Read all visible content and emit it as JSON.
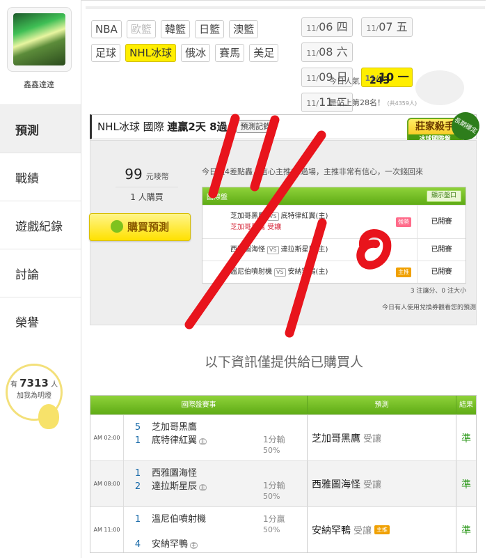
{
  "user": {
    "name": "鑫鑫達達"
  },
  "nav": [
    {
      "label": "預測",
      "active": true
    },
    {
      "label": "戰績"
    },
    {
      "label": "遊戲紀錄"
    },
    {
      "label": "討論"
    },
    {
      "label": "榮譽"
    }
  ],
  "fans": {
    "prefix": "有",
    "count": "7313",
    "suffix": "人",
    "subtitle": "加我為明燈"
  },
  "categories": [
    {
      "label": "NBA"
    },
    {
      "label": "歐籃",
      "disabled": true
    },
    {
      "label": "韓籃"
    },
    {
      "label": "日籃"
    },
    {
      "label": "澳籃"
    },
    {
      "label": "足球"
    },
    {
      "label": "NHL冰球",
      "active": true
    },
    {
      "label": "俄冰"
    },
    {
      "label": "賽馬"
    },
    {
      "label": "美足"
    }
  ],
  "dates": [
    {
      "md": "11/",
      "d": "06",
      "w": "四"
    },
    {
      "md": "11/",
      "d": "07",
      "w": "五"
    },
    {
      "md": "11/",
      "d": "08",
      "w": "六"
    },
    {
      "md": "11/",
      "d": "09",
      "w": "日"
    },
    {
      "md": "11/",
      "d": "10",
      "w": "一",
      "active": true
    },
    {
      "md": "11/",
      "d": "11",
      "w": "二"
    }
  ],
  "stats": {
    "popularity_label": "今日人氣",
    "popularity_value": "243",
    "rank_text": "是站上第28名！",
    "rank_note": "(共4359人)"
  },
  "prediction": {
    "league": "NHL冰球 國際",
    "streak": "連贏2天 8過",
    "record_button": "預測記錄",
    "badge_title": "莊家殺手",
    "badge_sub": "冰球國際盤",
    "badge_long": "長期穩定",
    "price": "99",
    "price_unit": "元嘜幣",
    "buyers": "1 人購買",
    "buy_button": "購買預測",
    "note": "今日過4差點轟，信心主推99過場，主推非常有信心，一次錢回來",
    "mini_header": "國際盤",
    "mini_show_button": "顯示盤口",
    "mini_rows": [
      {
        "away": "芝加哥黑鷹",
        "vs": "VS",
        "home": "底特律紅翼(主)",
        "pick": "芝加哥黑鷹 受讓",
        "tag": "強勢",
        "tag_style": "pink",
        "status": "已開賽"
      },
      {
        "away": "西雅圖海怪",
        "vs": "VS",
        "home": "達拉斯星辰(主)",
        "pick": "",
        "tag": "",
        "status": "已開賽"
      },
      {
        "away": "溫尼伯噴射機",
        "vs": "VS",
        "home": "安納罕鴨(主)",
        "pick": "",
        "tag": "主推",
        "tag_style": "orange",
        "status": "已開賽"
      }
    ],
    "mini_foot": "3 注讓分、0 注大小",
    "mini_foot2": "今日有人使用兌換券觀看您的預測"
  },
  "info_text": "以下資訊僅提供給已購買人",
  "results": {
    "headers": {
      "event": "國際盤賽事",
      "pred": "預測",
      "result": "結果"
    },
    "rows": [
      {
        "time": "AM 02:00",
        "s1": "5",
        "t1": "芝加哥黑鷹",
        "s2": "1",
        "t2": "底特律紅翼",
        "home_mark": "主",
        "line1": "1分輸",
        "line2": "50%",
        "pick": "芝加哥黑鷹",
        "pick_sub": "受讓",
        "mark": "",
        "result": "準"
      },
      {
        "time": "AM 08:00",
        "s1": "1",
        "t1": "西雅圖海怪",
        "s2": "2",
        "t2": "達拉斯星辰",
        "home_mark": "主",
        "line1": "1分輸",
        "line2": "50%",
        "pick": "西雅圖海怪",
        "pick_sub": "受讓",
        "mark": "",
        "result": "準"
      },
      {
        "time": "AM 11:00",
        "s1": "1",
        "t1": "溫尼伯噴射機",
        "s2": "4",
        "t2": "安納罕鴨",
        "home_mark": "主",
        "line1": "1分贏",
        "line2": "50%",
        "pick": "安納罕鴨",
        "pick_sub": "受讓",
        "mark": "主推",
        "result": "準"
      }
    ]
  },
  "overlay": {
    "color": "#e8141c"
  }
}
